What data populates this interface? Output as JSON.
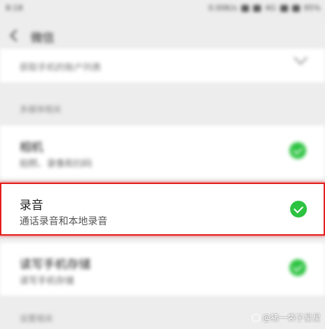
{
  "status_bar": {
    "time": "8:18",
    "speed": "0.00K/s",
    "network": "4G",
    "battery": "95%"
  },
  "header": {
    "title": "微信"
  },
  "top_card": {
    "subtitle": "获取手机的账户列表"
  },
  "sections": {
    "multimedia_label": "多媒体相关",
    "settings_label": "设置相关"
  },
  "rows": {
    "camera": {
      "title": "相机",
      "subtitle": "拍照、录像和扫码"
    },
    "recording": {
      "title": "录音",
      "subtitle": "通话录音和本地录音"
    },
    "storage": {
      "title": "读写手机存储",
      "subtitle": "读写手机存储"
    }
  },
  "watermark": {
    "text": "@猪一袋子星星"
  },
  "colors": {
    "check_green": "#2cc341",
    "highlight_red": "#e41e1e",
    "page_background": "#ededed"
  }
}
